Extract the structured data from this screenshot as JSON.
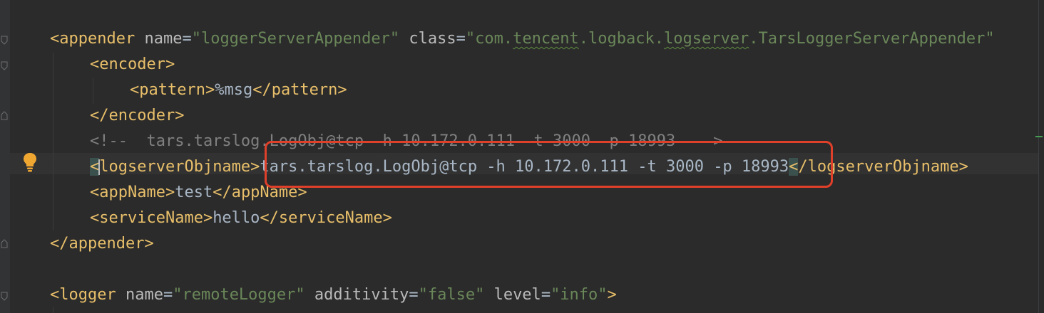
{
  "editor": {
    "lines": {
      "appender_open": {
        "lt": "<",
        "tag": "appender",
        "attr1": " name",
        "eq1": "=",
        "val1": "\"loggerServerAppender\"",
        "attr2": " class",
        "eq2": "=",
        "val2_q": "\"com.",
        "val2_a": "tencent",
        "val2_b": ".logback.",
        "val2_c": "logserver",
        "val2_d": ".TarsLoggerServerAppender\""
      },
      "encoder_open": "<encoder>",
      "pattern": {
        "open": "<pattern>",
        "text": "%msg",
        "close": "</pattern>"
      },
      "encoder_close": "</encoder>",
      "comment": "<!--  tars.tarslog.LogObj@tcp -h 10.172.0.111 -t 3000 -p 18993  -->",
      "logserver": {
        "lt": "<",
        "open_rest": "logserverObjname>",
        "text": "tars.tarslog.LogObj@tcp -h 10.172.0.111 -t 3000 -p 18993",
        "close_lt": "<",
        "close_rest": "/logserverObjname>"
      },
      "appname": {
        "open": "<appName>",
        "text": "test",
        "close": "</appName>"
      },
      "servicename": {
        "open": "<serviceName>",
        "text": "hello",
        "close": "</serviceName>"
      },
      "appender_close": "</appender>",
      "logger_open": {
        "lt": "<",
        "tag": "logger",
        "attr1": " name",
        "eq1": "=",
        "val1": "\"remoteLogger\"",
        "attr2": " additivity",
        "eq2": "=",
        "val2": "\"false\"",
        "attr3": " level",
        "eq3": "=",
        "val3": "\"info\"",
        "gt": ">"
      }
    },
    "icons": {
      "intention": "lightbulb-icon",
      "fold": "fold-marker-icon"
    },
    "colors": {
      "background": "#2b2b2b",
      "tag": "#e8bf6a",
      "attribute": "#bababa",
      "string": "#6a8759",
      "text": "#a9b7c6",
      "comment": "#808080",
      "annotation_box": "#e0402a"
    }
  }
}
